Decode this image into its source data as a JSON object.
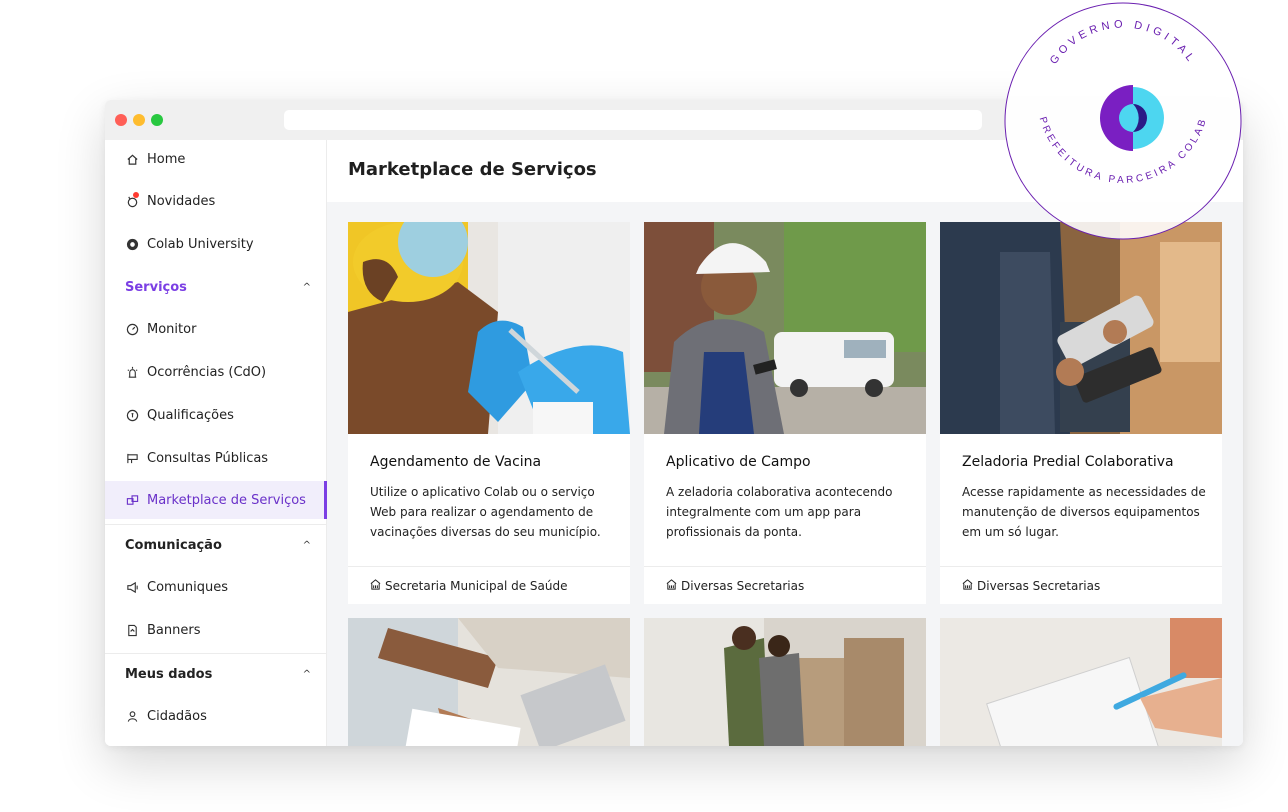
{
  "sidebar": {
    "items": [
      {
        "label": "Home",
        "icon": "home-icon"
      },
      {
        "label": "Novidades",
        "icon": "bell-icon"
      },
      {
        "label": "Colab University",
        "icon": "university-icon"
      }
    ],
    "sections": [
      {
        "label": "Serviços",
        "items": [
          {
            "label": "Monitor",
            "icon": "gauge-icon"
          },
          {
            "label": "Ocorrências (CdO)",
            "icon": "alarm-icon"
          },
          {
            "label": "Qualificações",
            "icon": "rating-icon"
          },
          {
            "label": "Consultas Públicas",
            "icon": "consult-icon"
          },
          {
            "label": "Marketplace de Serviços",
            "icon": "marketplace-icon",
            "active": true
          }
        ]
      },
      {
        "label": "Comunicação",
        "items": [
          {
            "label": "Comuniques",
            "icon": "megaphone-icon"
          },
          {
            "label": "Banners",
            "icon": "banner-icon"
          }
        ]
      },
      {
        "label": "Meus dados",
        "items": [
          {
            "label": "Cidadãos",
            "icon": "user-icon"
          }
        ]
      }
    ]
  },
  "main": {
    "title": "Marketplace de Serviços",
    "cards": [
      {
        "title": "Agendamento de Vacina",
        "description": "Utilize o aplicativo Colab ou o serviço Web para realizar o agendamento de vacinações diversas do seu município.",
        "department": "Secretaria Municipal de Saúde"
      },
      {
        "title": "Aplicativo de Campo",
        "description": "A zeladoria colaborativa acontecendo integralmente com um app para profissionais da ponta.",
        "department": "Diversas Secretarias"
      },
      {
        "title": "Zeladoria Predial Colaborativa",
        "description": "Acesse rapidamente as necessidades de manutenção de diversos equipamentos em um só lugar.",
        "department": "Diversas Secretarias"
      }
    ]
  },
  "seal": {
    "top_text": "GOVERNO DIGITAL",
    "bottom_text": "PREFEITURA PARCEIRA COLAB"
  },
  "colors": {
    "accent": "#7b3fe4",
    "seal_ring": "#6a1fb0",
    "logo_cyan": "#4dd6f0",
    "logo_purple": "#7a1fc2"
  }
}
